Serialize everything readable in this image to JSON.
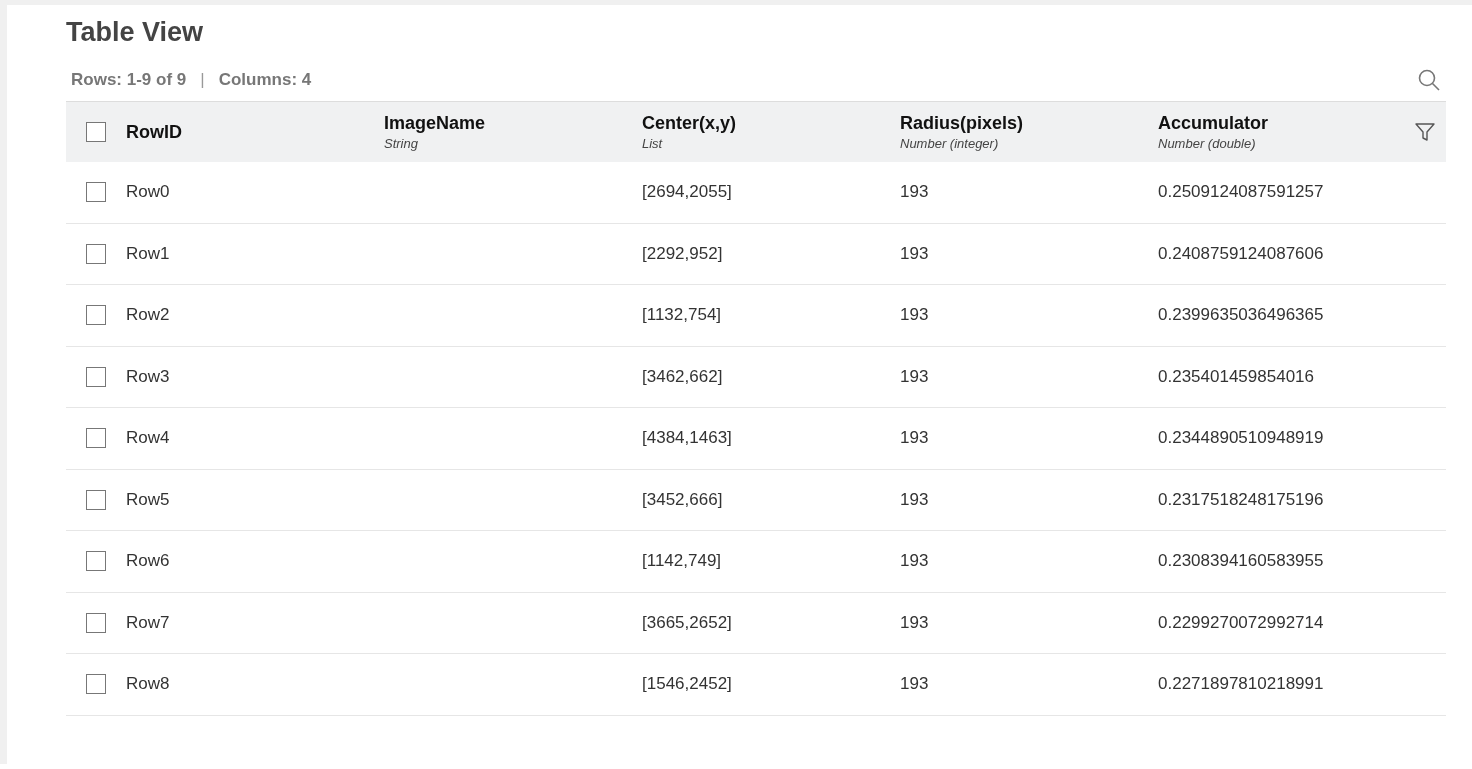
{
  "title": "Table View",
  "summary": {
    "rows": "Rows: 1-9 of 9",
    "separator": "|",
    "columns": "Columns: 4"
  },
  "header": {
    "checked": false,
    "columns": [
      {
        "name": "RowID"
      },
      {
        "name": "ImageName",
        "type": "String"
      },
      {
        "name": "Center(x,y)",
        "type": "List"
      },
      {
        "name": "Radius(pixels)",
        "type": "Number (integer)"
      },
      {
        "name": "Accumulator",
        "type": "Number (double)"
      }
    ]
  },
  "rows": [
    {
      "checked": false,
      "cells": [
        "Row0",
        null,
        "[2694,2055]",
        "193",
        "0.2509124087591257"
      ]
    },
    {
      "checked": false,
      "cells": [
        "Row1",
        null,
        "[2292,952]",
        "193",
        "0.2408759124087606"
      ]
    },
    {
      "checked": false,
      "cells": [
        "Row2",
        null,
        "[1132,754]",
        "193",
        "0.2399635036496365"
      ]
    },
    {
      "checked": false,
      "cells": [
        "Row3",
        null,
        "[3462,662]",
        "193",
        "0.235401459854016"
      ]
    },
    {
      "checked": false,
      "cells": [
        "Row4",
        null,
        "[4384,1463]",
        "193",
        "0.2344890510948919"
      ]
    },
    {
      "checked": false,
      "cells": [
        "Row5",
        null,
        "[3452,666]",
        "193",
        "0.2317518248175196"
      ]
    },
    {
      "checked": false,
      "cells": [
        "Row6",
        null,
        "[1142,749]",
        "193",
        "0.2308394160583955"
      ]
    },
    {
      "checked": false,
      "cells": [
        "Row7",
        null,
        "[3665,2652]",
        "193",
        "0.2299270072992714"
      ]
    },
    {
      "checked": false,
      "cells": [
        "Row8",
        null,
        "[1546,2452]",
        "193",
        "0.2271897810218991"
      ]
    }
  ]
}
